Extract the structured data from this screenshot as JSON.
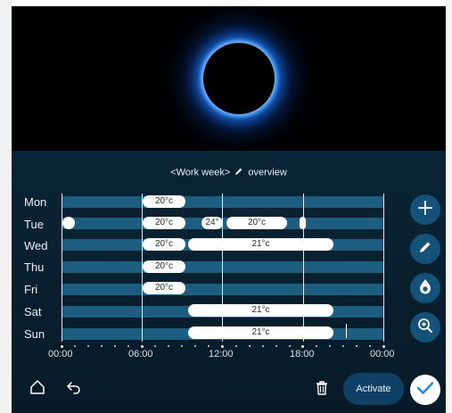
{
  "header": {
    "prefix": "<Work week>",
    "suffix": "overview"
  },
  "days": [
    "Mon",
    "Tue",
    "Wed",
    "Thu",
    "Fri",
    "Sat",
    "Sun"
  ],
  "schedule": {
    "mon": [
      "20°c"
    ],
    "tue": [
      "20°c",
      "24°",
      "20°c"
    ],
    "wed": [
      "20°c",
      "21°c"
    ],
    "thu": [
      "20°c"
    ],
    "fri": [
      "20°c"
    ],
    "sat": [
      "21°c"
    ],
    "sun": [
      "21°c"
    ]
  },
  "time_axis": [
    "00:00",
    "06:00",
    "12:00",
    "18:00",
    "00:00"
  ],
  "side_actions": [
    "plus-icon",
    "pencil-icon",
    "flame-icon",
    "zoom-in-icon"
  ],
  "footer": {
    "activate_label": "Activate"
  },
  "icons": {
    "home": "home-icon",
    "back": "back-arrow-icon",
    "delete": "trash-icon",
    "confirm": "checkmark-icon"
  },
  "colors": {
    "accent": "#1d5d80",
    "background": "#081a27",
    "confirm": "#1a8ce0"
  }
}
